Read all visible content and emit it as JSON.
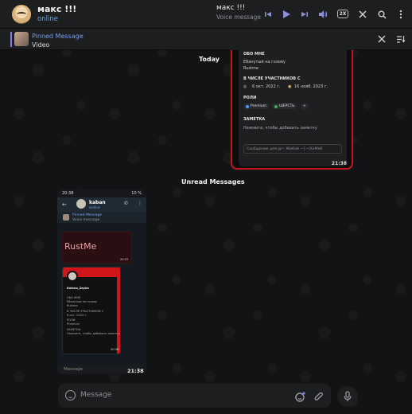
{
  "header": {
    "chat_title": "макс !!!",
    "chat_status": "online",
    "player_title": "макс !!!",
    "player_subtitle": "Voice message",
    "speed_label": "2X"
  },
  "pinned": {
    "title": "Pinned Message",
    "subtitle": "Video"
  },
  "separators": {
    "today": "Today",
    "unread": "Unread Messages"
  },
  "message1": {
    "about_heading": "ОБО МНЕ",
    "about_line1": "Ебанутый на голову",
    "about_line2": "Rustme",
    "member_heading": "В ЧИСЛЕ УЧАСТНИКОВ С",
    "member_date1": "6 окт. 2022 г.",
    "member_date2": "16 нояб. 2023 г.",
    "roles_heading": "РОЛИ",
    "roles": [
      "Premium",
      "ШЕРСТЬ",
      "+"
    ],
    "note_heading": "ЗАМЕТКА",
    "note_text": "Нажмите, чтобы добавить заметку",
    "input_text": "Сообщение для @~ Жибей ~}~(XxMeK",
    "time": "21:38"
  },
  "message2": {
    "status_time": "20:38",
    "status_battery": "10 %",
    "contact_name": "kaban",
    "contact_status": "online",
    "pinned_title": "Pinned Message",
    "pinned_sub": "Voice message",
    "rustme_text": "RustMe",
    "rustme_time": "20:37",
    "card_name": "Koleno_Zayka",
    "card_time": "20:38",
    "input_placeholder": "Message",
    "time": "21:38"
  },
  "composer": {
    "placeholder": "Message"
  },
  "colors": {
    "accent": "#7d7ff0",
    "link": "#6ea7e8",
    "red": "#d0161b"
  }
}
